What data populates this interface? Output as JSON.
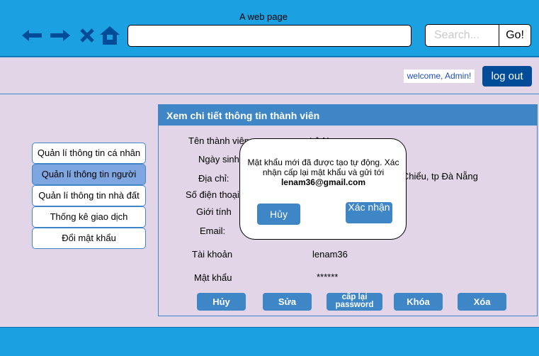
{
  "browser": {
    "title": "A web page",
    "url": "",
    "search_placeholder": "Search...",
    "go_label": "Go!",
    "icons": [
      "back-arrow-icon",
      "forward-arrow-icon",
      "close-icon",
      "home-icon"
    ]
  },
  "header": {
    "welcome_text": "welcome, Admin!",
    "logout_label": "log out"
  },
  "sidebar": {
    "items": [
      {
        "label": "Quản lí thông tin cá nhân"
      },
      {
        "label": "Quản lí thông tin người dùng"
      },
      {
        "label": "Quản lí thông tin nhà đất"
      },
      {
        "label": "Thống kê giao dịch"
      },
      {
        "label": "Đổi mật khẩu"
      }
    ]
  },
  "panel": {
    "title": "Xem chi tiết thông tin thành viên",
    "fields": [
      {
        "label": "Tên thành viên",
        "value": "Lê Nam"
      },
      {
        "label": "Ngày sinh:",
        "value": ""
      },
      {
        "label": "Địa chỉ:",
        "value": "n Chiểu, tp Đà Nẵng"
      },
      {
        "label": "Số điện thoại",
        "value": ""
      },
      {
        "label": "Giới tính",
        "value": ""
      },
      {
        "label": "Email:",
        "value": ""
      },
      {
        "label": "Tài khoản",
        "value": "lenam36"
      },
      {
        "label": "Mật khẩu",
        "value": "******"
      }
    ],
    "buttons": {
      "cancel": "Hủy",
      "edit": "Sửa",
      "reset": "cấp lại password",
      "lock": "Khóa",
      "delete": "Xóa"
    }
  },
  "dialog": {
    "message": "Mật khẩu mới đã được tạo tự động. Xác nhận cấp lại mật khẩu và gửi tới",
    "email": "lenam36@gmail.com",
    "cancel_label": "Hủy",
    "confirm_label": "Xác nhận"
  },
  "colors": {
    "browser_bar": "#1ba1e2",
    "background": "#e1d5e7",
    "accent": "#3f86c6",
    "logout": "#004c99"
  }
}
